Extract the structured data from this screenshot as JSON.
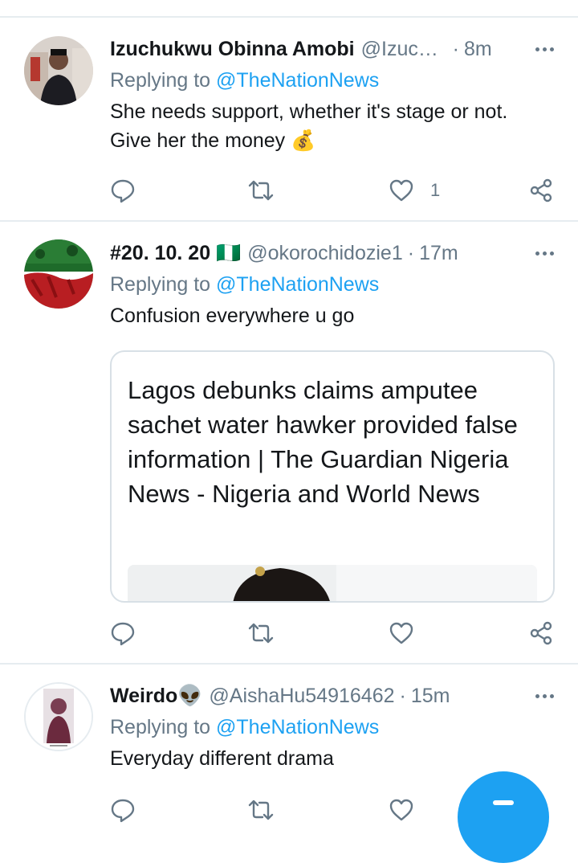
{
  "tweets": [
    {
      "display_name": "Izuchukwu Obinna Amobi",
      "handle": "@Izuch…",
      "dot": "·",
      "time": "8m",
      "reply_prefix": "Replying to",
      "reply_to": "@TheNationNews",
      "text": "She needs support, whether it's stage or not. Give her the money 💰",
      "likes": "1"
    },
    {
      "display_name": "#20. 10. 20 🇳🇬",
      "handle": "@okorochidozie1",
      "dot": "·",
      "time": "17m",
      "reply_prefix": "Replying to",
      "reply_to": "@TheNationNews",
      "text": "Confusion everywhere u go",
      "card_title": "Lagos debunks claims amputee sachet water hawker provided false information | The Guardian Nigeria News - Nigeria and World News"
    },
    {
      "display_name": "Weirdo👽",
      "handle": "@AishaHu54916462",
      "dot": "·",
      "time": "15m",
      "reply_prefix": "Replying to",
      "reply_to": "@TheNationNews",
      "text": "Everyday different drama"
    }
  ],
  "colors": {
    "accent": "#1da1f2",
    "secondary_text": "#657786",
    "primary_text": "#14171a",
    "divider": "#e6ecf0"
  },
  "icons": [
    "reply-icon",
    "retweet-icon",
    "like-icon",
    "share-icon",
    "more-icon",
    "compose-icon"
  ]
}
